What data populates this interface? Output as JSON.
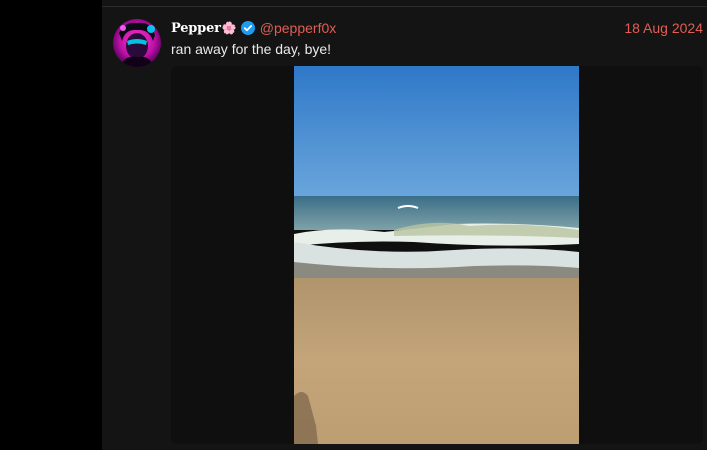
{
  "post": {
    "author": {
      "display_name": "Pepper",
      "name_emoji": "🌸",
      "verified": true,
      "handle": "@pepperf0x"
    },
    "date": "18 Aug 2024",
    "text": "ran away for the day, bye!",
    "media": {
      "type": "photo",
      "icon": "beach-photo"
    }
  },
  "colors": {
    "accent": "#e15e56",
    "verified_badge": "#1d9bf0",
    "background": "#141414"
  }
}
